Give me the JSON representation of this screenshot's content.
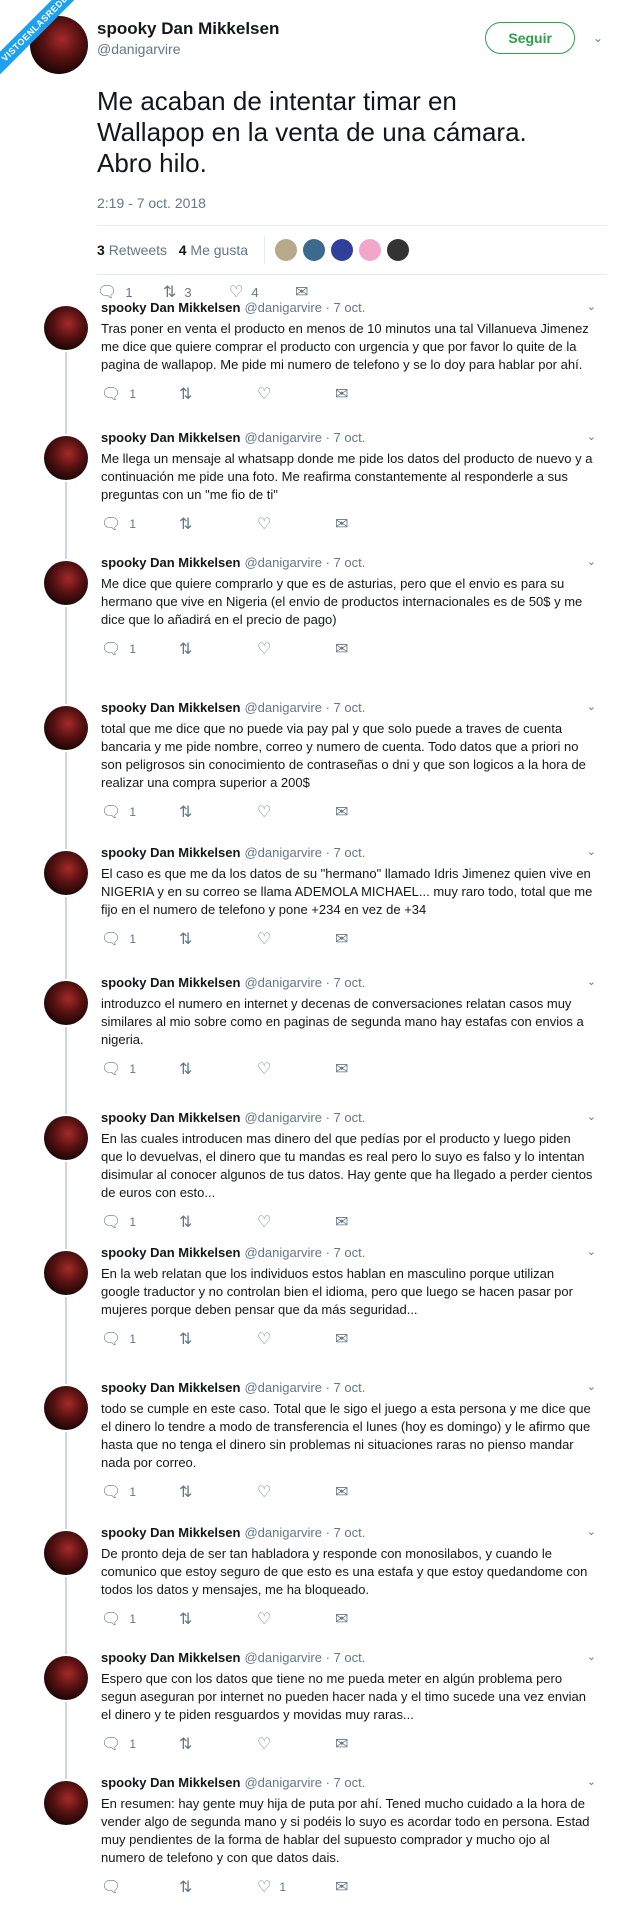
{
  "watermark": "VISTOENLASREDES",
  "main": {
    "display_name": "spooky Dan Mikkelsen",
    "handle": "@danigarvire",
    "follow_label": "Seguir",
    "text": "Me acaban de intentar timar en Wallapop en la venta de una cámara. Abro hilo.",
    "timestamp": "2:19 - 7 oct. 2018",
    "retweets_count": "3",
    "retweets_label": "Retweets",
    "likes_count": "4",
    "likes_label": "Me gusta",
    "replies": "1",
    "retweets": "3",
    "likes": "4"
  },
  "tweets": [
    {
      "name": "spooky Dan Mikkelsen",
      "meta": "@danigarvire · 7 oct.",
      "text": "Tras poner en venta el producto en menos de 10 minutos una tal Villanueva Jimenez me dice que quiere comprar el producto con urgencia y que por favor lo quite de la pagina de wallapop. Me pide mi numero de telefono y se lo doy para hablar por ahí.",
      "replies": "1",
      "retweets": "",
      "likes": ""
    },
    {
      "name": "spooky Dan Mikkelsen",
      "meta": "@danigarvire · 7 oct.",
      "text": "Me llega un mensaje al whatsapp donde me pide los datos del producto de nuevo y a continuación me pide una foto. Me reafirma constantemente al responderle a sus preguntas con un \"me fio de ti\"",
      "replies": "1",
      "retweets": "",
      "likes": ""
    },
    {
      "name": "spooky Dan Mikkelsen",
      "meta": "@danigarvire · 7 oct.",
      "text": "Me dice que quiere comprarlo y que es de asturias, pero que el envio es para su hermano que vive en Nigeria (el envio de productos internacionales es de 50$ y me dice que lo añadirá en el precio de pago)",
      "replies": "1",
      "retweets": "",
      "likes": ""
    },
    {
      "name": "spooky Dan Mikkelsen",
      "meta": "@danigarvire · 7 oct.",
      "text": "total que me dice que no puede via pay pal y que solo puede a traves de cuenta bancaria y me pide nombre, correo y numero de cuenta. Todo datos que a priori no son peligrosos sin conocimiento de contraseñas o dni y que son logicos a la hora de realizar una compra superior a 200$",
      "replies": "1",
      "retweets": "",
      "likes": ""
    },
    {
      "name": "spooky Dan Mikkelsen",
      "meta": "@danigarvire · 7 oct.",
      "text": "El caso es que me da los datos de su \"hermano\" llamado Idris Jimenez quien vive en NIGERIA y en su correo se llama ADEMOLA MICHAEL... muy raro todo, total que me fijo en el numero de telefono y pone +234 en vez de +34",
      "replies": "1",
      "retweets": "",
      "likes": ""
    },
    {
      "name": "spooky Dan Mikkelsen",
      "meta": "@danigarvire · 7 oct.",
      "text": "introduzco el numero en internet y decenas de conversaciones relatan casos muy similares al mio sobre como en paginas de segunda mano hay estafas con envios a nigeria.",
      "replies": "1",
      "retweets": "",
      "likes": ""
    },
    {
      "name": "spooky Dan Mikkelsen",
      "meta": "@danigarvire · 7 oct.",
      "text": "En las cuales introducen mas dinero del que pedías por el producto y luego piden que lo devuelvas, el dinero que tu mandas es real pero lo suyo es falso y lo intentan disimular al conocer algunos de tus datos. Hay gente que ha llegado a perder cientos de euros con esto...",
      "replies": "1",
      "retweets": "",
      "likes": ""
    },
    {
      "name": "spooky Dan Mikkelsen",
      "meta": "@danigarvire · 7 oct.",
      "text": "En la web relatan que los individuos estos hablan en masculino porque utilizan google traductor y no controlan bien el idioma, pero que luego se hacen pasar por mujeres porque deben pensar que da más seguridad...",
      "replies": "1",
      "retweets": "",
      "likes": ""
    },
    {
      "name": "spooky Dan Mikkelsen",
      "meta": "@danigarvire · 7 oct.",
      "text": "todo se cumple en este caso. Total que le sigo el juego a esta persona y me dice que el dinero lo tendre a modo de transferencia el lunes (hoy es domingo) y le afirmo que hasta que no tenga el dinero sin problemas ni situaciones raras no pienso mandar nada por correo.",
      "replies": "1",
      "retweets": "",
      "likes": ""
    },
    {
      "name": "spooky Dan Mikkelsen",
      "meta": "@danigarvire · 7 oct.",
      "text": "De pronto deja de ser tan habladora y responde con monosilabos, y cuando le comunico que estoy seguro de que esto es una estafa y que estoy quedandome con todos los datos y mensajes, me ha bloqueado.",
      "replies": "1",
      "retweets": "",
      "likes": ""
    },
    {
      "name": "spooky Dan Mikkelsen",
      "meta": "@danigarvire · 7 oct.",
      "text": "Espero que con los datos que tiene no me pueda meter en algún problema pero segun aseguran por internet no pueden hacer nada y el timo sucede una vez envian el dinero y te piden resguardos y movidas muy raras...",
      "replies": "1",
      "retweets": "",
      "likes": ""
    },
    {
      "name": "spooky Dan Mikkelsen",
      "meta": "@danigarvire · 7 oct.",
      "text": "En resumen: hay gente muy hija de puta por ahí. Tened mucho cuidado a la hora de vender algo de segunda mano y si podéis lo suyo es acordar todo en persona. Estad muy pendientes de la forma de hablar del supuesto comprador y mucho ojo al numero de telefono y con que datos dais.",
      "replies": "",
      "retweets": "",
      "likes": "1"
    }
  ]
}
